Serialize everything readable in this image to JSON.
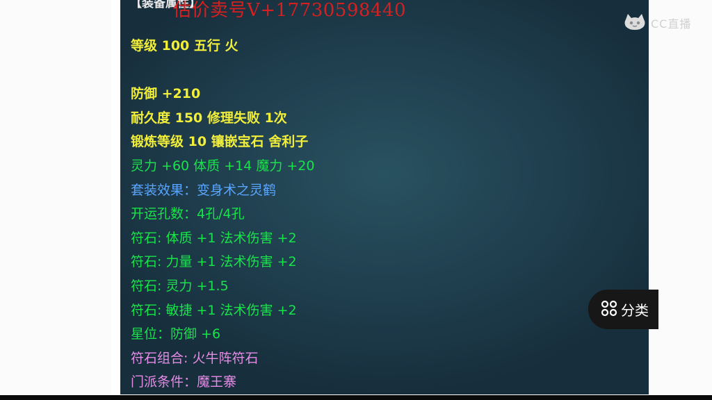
{
  "panel": {
    "top_line": "【装备属性】",
    "watermark": "估价卖号V+17730598440",
    "lines": [
      {
        "text": "等级 100 五行 火",
        "tone": "yellow"
      },
      {
        "text": "",
        "tone": "gap"
      },
      {
        "text": "防御 +210",
        "tone": "yellow"
      },
      {
        "text": "耐久度 150 修理失败 1次",
        "tone": "yellow"
      },
      {
        "text": "锻炼等级 10 镶嵌宝石 舍利子",
        "tone": "yellow"
      },
      {
        "text": "灵力 +60 体质 +14 魔力 +20",
        "tone": "green"
      },
      {
        "text": "套装效果：变身术之灵鹤",
        "tone": "blue"
      },
      {
        "text": "开运孔数：4孔/4孔",
        "tone": "green"
      },
      {
        "text": "符石: 体质 +1 法术伤害 +2",
        "tone": "green"
      },
      {
        "text": "符石: 力量 +1 法术伤害 +2",
        "tone": "green"
      },
      {
        "text": "符石: 灵力 +1.5",
        "tone": "green"
      },
      {
        "text": "符石: 敏捷 +1 法术伤害 +2",
        "tone": "green"
      },
      {
        "text": "星位：防御 +6",
        "tone": "green"
      },
      {
        "text": "符石组合: 火牛阵符石",
        "tone": "pink"
      },
      {
        "text": "门派条件：魔王寨",
        "tone": "pink"
      }
    ]
  },
  "logo": {
    "text": "CC直播",
    "icon": "cat-face-icon"
  },
  "category_button": {
    "label": "分类",
    "icon": "grid-icon"
  },
  "colors": {
    "yellow": "#f2ef3b",
    "green": "#19e34a",
    "blue": "#5aa6ff",
    "pink": "#e58ce6",
    "watermark": "#d62020"
  }
}
